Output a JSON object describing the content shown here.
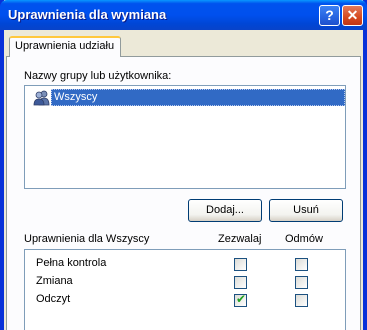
{
  "window": {
    "title": "Uprawnienia dla wymiana",
    "help_label": "?",
    "close_label": "✕"
  },
  "tab": {
    "label": "Uprawnienia udziału"
  },
  "users": {
    "label": "Nazwy grupy lub użytkownika:",
    "items": [
      {
        "name": "Wszyscy",
        "selected": true,
        "icon": "users-group-icon"
      }
    ],
    "add_label": "Dodaj...",
    "remove_label": "Usuń"
  },
  "permissions": {
    "header": "Uprawnienia dla Wszyscy",
    "allow_header": "Zezwalaj",
    "deny_header": "Odmów",
    "rows": [
      {
        "name": "Pełna kontrola",
        "allow": false,
        "deny": false
      },
      {
        "name": "Zmiana",
        "allow": false,
        "deny": false
      },
      {
        "name": "Odczyt",
        "allow": true,
        "deny": false
      }
    ]
  },
  "colors": {
    "titlebar": "#0053EE",
    "selection": "#316AC5",
    "tab_highlight": "#FFC83C",
    "checkmark": "#21A121"
  }
}
